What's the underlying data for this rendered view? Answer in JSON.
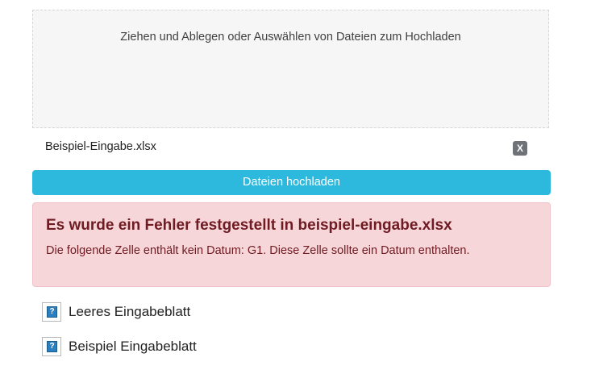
{
  "dropzone": {
    "text": "Ziehen und Ablegen oder Auswählen von Dateien zum Hochladen"
  },
  "file": {
    "name": "Beispiel-Eingabe.xlsx",
    "remove_label": "X"
  },
  "upload": {
    "button_label": "Dateien hochladen"
  },
  "error": {
    "title": "Es wurde ein Fehler festgestellt in beispiel-eingabe.xlsx",
    "message": "Die folgende Zelle enthält kein Datum: G1. Diese Zelle sollte ein Datum enthalten."
  },
  "links": [
    {
      "label": "Leeres Eingabeblatt",
      "icon": "help-document-icon"
    },
    {
      "label": "Beispiel Eingabeblatt",
      "icon": "help-document-icon"
    }
  ],
  "colors": {
    "upload_button": "#2db8de",
    "error_background": "#f7d6da",
    "error_text": "#6e1b22",
    "remove_badge": "#6f7378"
  }
}
